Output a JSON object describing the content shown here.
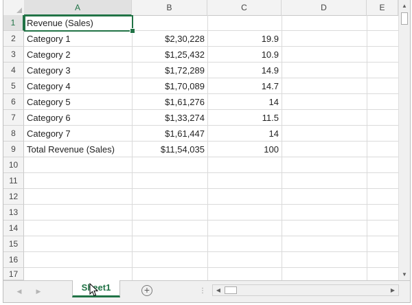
{
  "columns": [
    "A",
    "B",
    "C",
    "D",
    "E"
  ],
  "active_column": "A",
  "row_numbers": [
    "1",
    "2",
    "3",
    "4",
    "5",
    "6",
    "7",
    "8",
    "9",
    "10",
    "11",
    "12",
    "13",
    "14",
    "15",
    "16",
    "17"
  ],
  "active_row": "1",
  "rows": [
    {
      "a": "Revenue (Sales)",
      "b": "",
      "c": ""
    },
    {
      "a": "Category 1",
      "b": "$2,30,228",
      "c": "19.9"
    },
    {
      "a": "Category 2",
      "b": "$1,25,432",
      "c": "10.9"
    },
    {
      "a": "Category 3",
      "b": "$1,72,289",
      "c": "14.9"
    },
    {
      "a": "Category 4",
      "b": "$1,70,089",
      "c": "14.7"
    },
    {
      "a": "Category 5",
      "b": "$1,61,276",
      "c": "14"
    },
    {
      "a": "Category 6",
      "b": "$1,33,274",
      "c": "11.5"
    },
    {
      "a": "Category 7",
      "b": "$1,61,447",
      "c": "14"
    },
    {
      "a": "Total Revenue (Sales)",
      "b": "$11,54,035",
      "c": "100"
    }
  ],
  "sheet_tab": {
    "label": "Sheet1"
  },
  "icons": {
    "prev_sheet": "triangle-left-icon",
    "next_sheet": "triangle-right-icon",
    "add_sheet": "plus-circle-icon",
    "scroll_up": "triangle-up-icon",
    "scroll_down": "triangle-down-icon",
    "scroll_left": "triangle-left-icon",
    "scroll_right": "triangle-right-icon",
    "cursor": "mouse-pointer-icon"
  },
  "colors": {
    "accent": "#217346",
    "header_bg": "#f3f3f3",
    "grid_line": "#dadada"
  }
}
